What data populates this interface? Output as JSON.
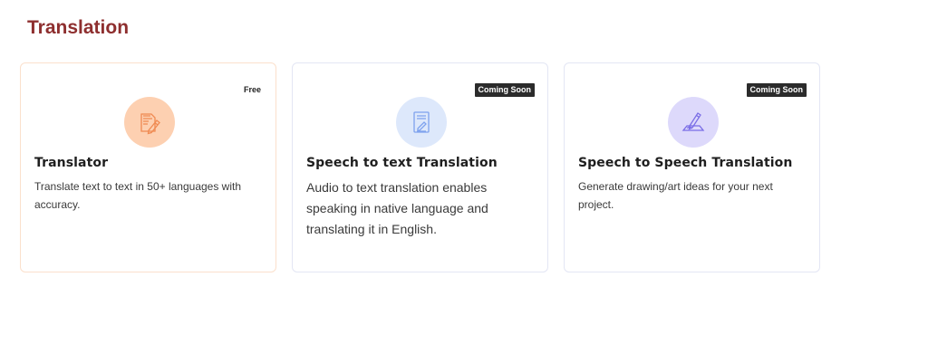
{
  "section": {
    "title": "Translation"
  },
  "cards": [
    {
      "badge": "Free",
      "icon": "document-pen-icon",
      "icon_color": "#f08a52",
      "title": "Translator",
      "description": "Translate text to text in 50+ languages with accuracy."
    },
    {
      "badge": "Coming Soon",
      "icon": "speech-document-icon",
      "icon_color": "#7ea2ee",
      "title": "Speech to text Translation",
      "description": "Audio to text translation enables speaking in native language and translating it in English."
    },
    {
      "badge": "Coming Soon",
      "icon": "pen-writing-icon",
      "icon_color": "#7a6de6",
      "title": "Speech to Speech Translation",
      "description": "Generate drawing/art ideas for your next project."
    }
  ],
  "colors": {
    "title": "#8e2f2f",
    "badge_dark": "#2b2b2b",
    "circle_orange": "#fdd0b1",
    "circle_blue": "#dde8fb",
    "circle_purple": "#ddd9fb"
  }
}
